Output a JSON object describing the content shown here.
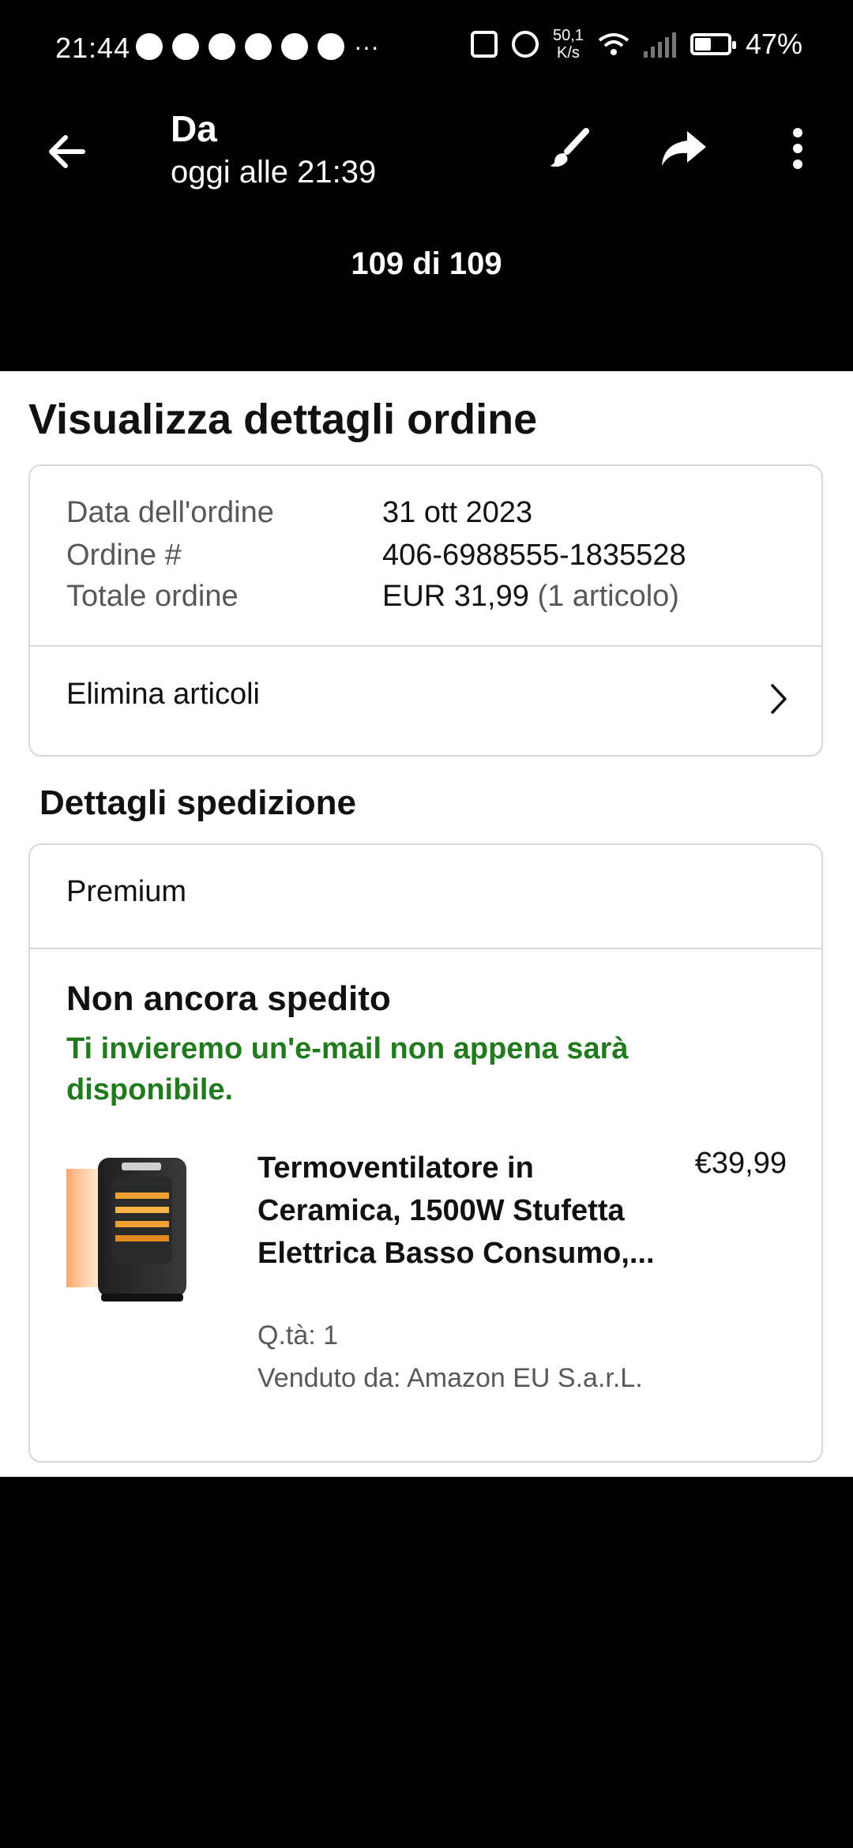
{
  "status_bar": {
    "time": "21:44",
    "more_indicator": "···",
    "net_speed_value": "50,1",
    "net_speed_unit": "K/s",
    "battery": "47%",
    "icons": [
      "eye-icon",
      "chat-bubble-icon",
      "whatsapp-icon",
      "messenger-icon",
      "temu-icon",
      "browser-icon",
      "nfc-icon",
      "alarm-icon",
      "wifi-icon",
      "signal-icon",
      "battery-icon"
    ]
  },
  "app_bar": {
    "title": "Da",
    "subtitle": "oggi alle 21:39",
    "counter": "109 di 109",
    "icons": [
      "back-arrow-icon",
      "brush-icon",
      "share-icon",
      "more-vert-icon"
    ]
  },
  "order": {
    "page_title": "Visualizza dettagli ordine",
    "date_label": "Data dell'ordine",
    "date_value": "31 ott 2023",
    "number_label": "Ordine #",
    "number_value": "406-6988555-1835528",
    "total_label": "Totale ordine",
    "total_value": "EUR 31,99",
    "total_items": "(1 articolo)",
    "remove_items": "Elimina articoli"
  },
  "shipping": {
    "section_title": "Dettagli spedizione",
    "service": "Premium",
    "status": "Non ancora spedito",
    "note": "Ti invieremo un'e-mail non appena sarà disponibile.",
    "product": {
      "title": "Termoventilatore in Ceramica, 1500W Stufetta Elettrica Basso Consumo,...",
      "price": "€39,99",
      "qty": "Q.tà: 1",
      "seller": "Venduto da: Amazon EU S.a.r.L."
    }
  },
  "colors": {
    "background": "#000000",
    "content": "#ffffff",
    "accent_green": "#227A1F",
    "muted_text": "#565959",
    "border": "#d5d9d9"
  }
}
